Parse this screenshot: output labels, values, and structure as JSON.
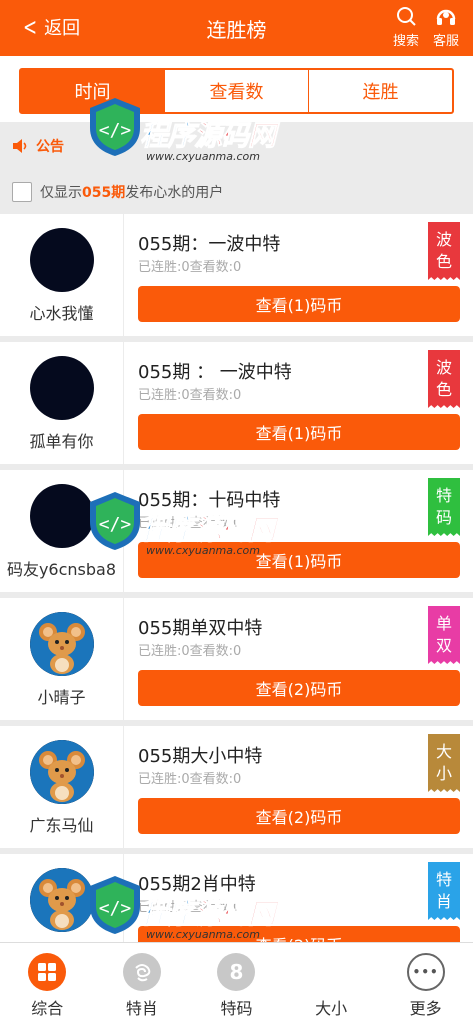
{
  "header": {
    "back_label": "返回",
    "title": "连胜榜",
    "search_label": "搜索",
    "service_label": "客服"
  },
  "tabs": [
    {
      "label": "时间",
      "active": true
    },
    {
      "label": "查看数",
      "active": false
    },
    {
      "label": "连胜",
      "active": false
    }
  ],
  "notice": {
    "label": "公告"
  },
  "filter": {
    "prefix": "仅显示",
    "issue": "055期",
    "suffix": "发布心水的用户",
    "checked": false
  },
  "posts": [
    {
      "user": "心水我懂",
      "avatar": "dark",
      "title": "055期：一波中特",
      "stats": "已连胜:0查看数:0",
      "button": "查看(1)码币",
      "tag": [
        "波",
        "色"
      ],
      "tag_color": "#e8383d"
    },
    {
      "user": "孤单有你",
      "avatar": "dark",
      "title": "055期 ： 一波中特",
      "stats": "已连胜:0查看数:0",
      "button": "查看(1)码币",
      "tag": [
        "波",
        "色"
      ],
      "tag_color": "#e8383d"
    },
    {
      "user": "码友y6cnsba8",
      "avatar": "dark",
      "title": "055期：十码中特",
      "stats": "已连胜:0查看数:0",
      "button": "查看(1)码币",
      "tag": [
        "特",
        "码"
      ],
      "tag_color": "#2fbf3f"
    },
    {
      "user": "小晴子",
      "avatar": "mouse",
      "title": "055期单双中特",
      "stats": "已连胜:0查看数:0",
      "button": "查看(2)码币",
      "tag": [
        "单",
        "双"
      ],
      "tag_color": "#e83ca5"
    },
    {
      "user": "广东马仙",
      "avatar": "mouse",
      "title": "055期大小中特",
      "stats": "已连胜:0查看数:0",
      "button": "查看(2)码币",
      "tag": [
        "大",
        "小"
      ],
      "tag_color": "#b8893a"
    },
    {
      "user": "",
      "avatar": "mouse",
      "title": "055期2肖中特",
      "stats": "已连胜:0查看数:0",
      "button": "查看(2)码币",
      "tag": [
        "特",
        "肖"
      ],
      "tag_color": "#2aa3e8"
    }
  ],
  "bottom_nav": [
    {
      "label": "综合",
      "icon": "grid-icon",
      "color": "#fa5a0a"
    },
    {
      "label": "特肖",
      "icon": "zodiac-icon",
      "color": "#c8c8c8"
    },
    {
      "label": "特码",
      "icon": "number-8-icon",
      "glyph": "8",
      "color": "#c8c8c8"
    },
    {
      "label": "大小",
      "icon": "",
      "color": ""
    },
    {
      "label": "更多",
      "icon": "more-icon",
      "glyph": "•••",
      "color": "#ffffff"
    }
  ],
  "watermark": {
    "text_a": "程序",
    "text_b": "源码网",
    "url": "www.cxyuanma.com"
  },
  "colors": {
    "accent": "#fa5a0a",
    "background": "#ebebeb"
  }
}
